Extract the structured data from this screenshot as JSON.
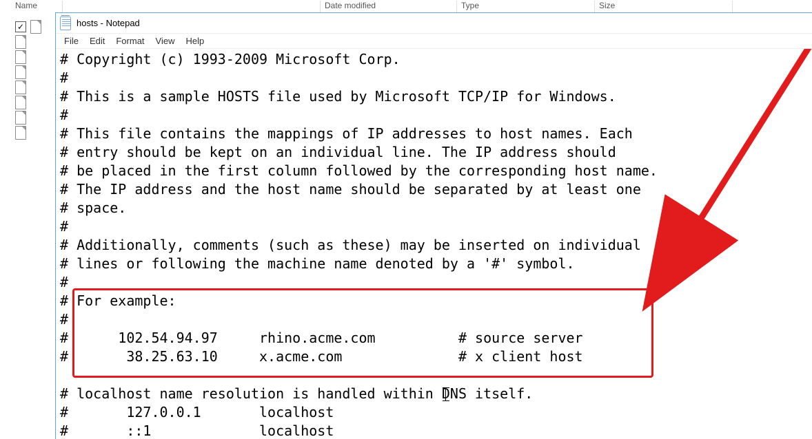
{
  "explorer": {
    "columns": {
      "name": "Name",
      "date": "Date modified",
      "type": "Type",
      "size": "Size"
    },
    "file_rows": 8
  },
  "notepad": {
    "title": "hosts - Notepad",
    "menus": {
      "file": "File",
      "edit": "Edit",
      "format": "Format",
      "view": "View",
      "help": "Help"
    }
  },
  "content": {
    "l1": "# Copyright (c) 1993-2009 Microsoft Corp.",
    "l2": "#",
    "l3": "# This is a sample HOSTS file used by Microsoft TCP/IP for Windows.",
    "l4": "#",
    "l5": "# This file contains the mappings of IP addresses to host names. Each",
    "l6": "# entry should be kept on an individual line. The IP address should",
    "l7": "# be placed in the first column followed by the corresponding host name.",
    "l8": "# The IP address and the host name should be separated by at least one",
    "l9": "# space.",
    "l10": "#",
    "l11": "# Additionally, comments (such as these) may be inserted on individual",
    "l12": "# lines or following the machine name denoted by a '#' symbol.",
    "l13": "#",
    "l14": "# For example:",
    "l15": "#",
    "l16": "#      102.54.94.97     rhino.acme.com          # source server",
    "l17": "#       38.25.63.10     x.acme.com              # x client host",
    "l18": "",
    "l19": "# localhost name resolution is handled within DNS itself.",
    "l20": "#       127.0.0.1       localhost",
    "l21": "#       ::1             localhost"
  }
}
